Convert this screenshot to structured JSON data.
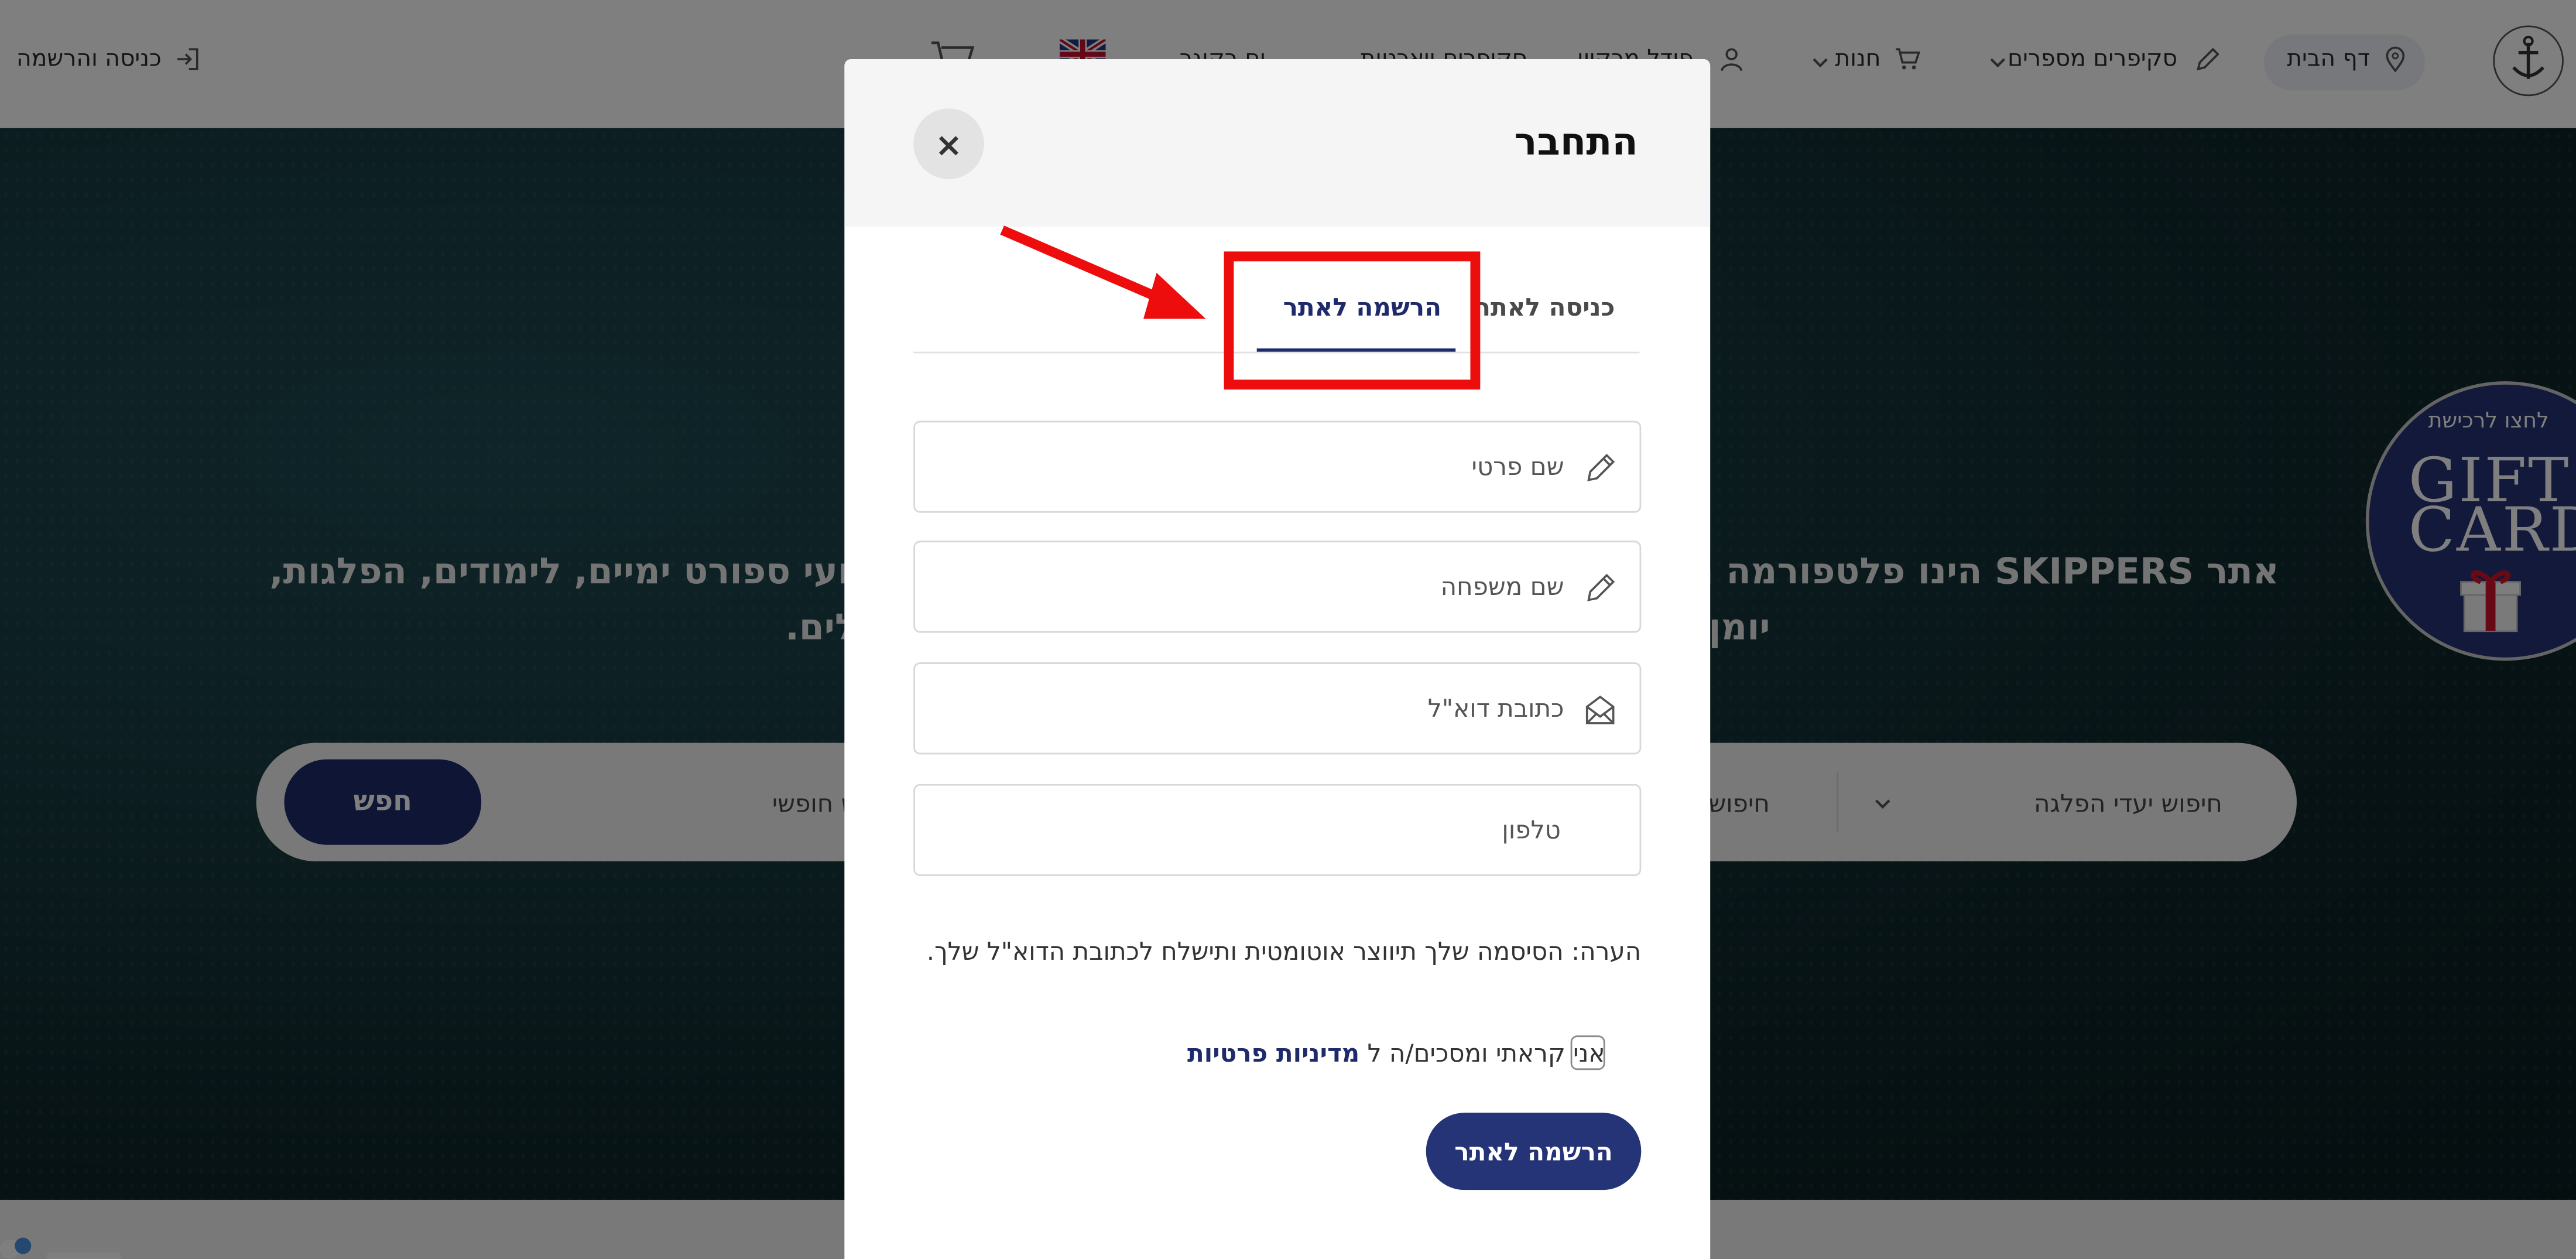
{
  "nav": {
    "home": "דף הבית",
    "skippers": "סקיפרים מספרים",
    "shop": "חנות",
    "login_register": "כניסה והרשמה",
    "item4": "פודל מרקיון",
    "item5": "סקיפרים ויאכטות",
    "item6": "ים רקוגר"
  },
  "hero": {
    "line1_right": "אתר SKIPPERS הינו פלטפורמה המ",
    "line1_left": "אירועי ספורט ימיים, לימודים, הפלגות,",
    "line2_right": "יומן",
    "line2_left": "לים."
  },
  "search": {
    "by_destination": "חיפוש יעדי הפלגה",
    "by_other": "חיפוש",
    "free_text": "חיפוש חופשי",
    "button": "חפש"
  },
  "gift": {
    "cta": "לחצו לרכישת",
    "title_line1": "GIFT",
    "title_line2": "CARD"
  },
  "modal": {
    "title": "התחבר",
    "close_glyph": "×",
    "tab_login": "כניסה לאתר",
    "tab_register": "הרשמה לאתר",
    "first_name_placeholder": "שם פרטי",
    "last_name_placeholder": "שם משפחה",
    "email_placeholder": "כתובת דוא\"ל",
    "phone_placeholder": "טלפון",
    "note": "הערה: הסיסמה שלך תיווצר אוטומטית ותישלח לכתובת הדוא\"ל שלך.",
    "consent_text": "אני קראתי ומסכים/ה ל",
    "privacy_link": "מדיניות פרטיות",
    "submit": "הרשמה לאתר"
  },
  "colors": {
    "primary": "#253377",
    "annotation_red": "#ee0d0d"
  }
}
